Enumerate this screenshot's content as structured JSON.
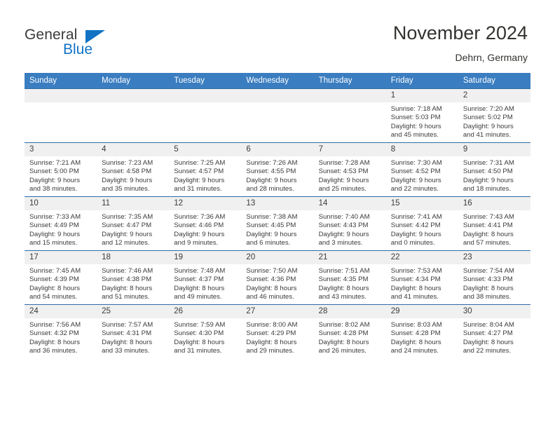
{
  "brand": {
    "name_part1": "General",
    "name_part2": "Blue",
    "logo_icon": "triangle-icon",
    "accent_color": "#1273c4"
  },
  "header": {
    "title": "November 2024",
    "location": "Dehrn, Germany"
  },
  "calendar": {
    "header_bg": "#3a7dc0",
    "daynum_bg": "#f0f0f0",
    "weekday_headers": [
      "Sunday",
      "Monday",
      "Tuesday",
      "Wednesday",
      "Thursday",
      "Friday",
      "Saturday"
    ],
    "weeks": [
      [
        {
          "day": "",
          "sunrise": "",
          "sunset": "",
          "daylight_line1": "",
          "daylight_line2": "",
          "empty": true
        },
        {
          "day": "",
          "sunrise": "",
          "sunset": "",
          "daylight_line1": "",
          "daylight_line2": "",
          "empty": true
        },
        {
          "day": "",
          "sunrise": "",
          "sunset": "",
          "daylight_line1": "",
          "daylight_line2": "",
          "empty": true
        },
        {
          "day": "",
          "sunrise": "",
          "sunset": "",
          "daylight_line1": "",
          "daylight_line2": "",
          "empty": true
        },
        {
          "day": "",
          "sunrise": "",
          "sunset": "",
          "daylight_line1": "",
          "daylight_line2": "",
          "empty": true
        },
        {
          "day": "1",
          "sunrise": "Sunrise: 7:18 AM",
          "sunset": "Sunset: 5:03 PM",
          "daylight_line1": "Daylight: 9 hours",
          "daylight_line2": "and 45 minutes.",
          "empty": false
        },
        {
          "day": "2",
          "sunrise": "Sunrise: 7:20 AM",
          "sunset": "Sunset: 5:02 PM",
          "daylight_line1": "Daylight: 9 hours",
          "daylight_line2": "and 41 minutes.",
          "empty": false
        }
      ],
      [
        {
          "day": "3",
          "sunrise": "Sunrise: 7:21 AM",
          "sunset": "Sunset: 5:00 PM",
          "daylight_line1": "Daylight: 9 hours",
          "daylight_line2": "and 38 minutes.",
          "empty": false
        },
        {
          "day": "4",
          "sunrise": "Sunrise: 7:23 AM",
          "sunset": "Sunset: 4:58 PM",
          "daylight_line1": "Daylight: 9 hours",
          "daylight_line2": "and 35 minutes.",
          "empty": false
        },
        {
          "day": "5",
          "sunrise": "Sunrise: 7:25 AM",
          "sunset": "Sunset: 4:57 PM",
          "daylight_line1": "Daylight: 9 hours",
          "daylight_line2": "and 31 minutes.",
          "empty": false
        },
        {
          "day": "6",
          "sunrise": "Sunrise: 7:26 AM",
          "sunset": "Sunset: 4:55 PM",
          "daylight_line1": "Daylight: 9 hours",
          "daylight_line2": "and 28 minutes.",
          "empty": false
        },
        {
          "day": "7",
          "sunrise": "Sunrise: 7:28 AM",
          "sunset": "Sunset: 4:53 PM",
          "daylight_line1": "Daylight: 9 hours",
          "daylight_line2": "and 25 minutes.",
          "empty": false
        },
        {
          "day": "8",
          "sunrise": "Sunrise: 7:30 AM",
          "sunset": "Sunset: 4:52 PM",
          "daylight_line1": "Daylight: 9 hours",
          "daylight_line2": "and 22 minutes.",
          "empty": false
        },
        {
          "day": "9",
          "sunrise": "Sunrise: 7:31 AM",
          "sunset": "Sunset: 4:50 PM",
          "daylight_line1": "Daylight: 9 hours",
          "daylight_line2": "and 18 minutes.",
          "empty": false
        }
      ],
      [
        {
          "day": "10",
          "sunrise": "Sunrise: 7:33 AM",
          "sunset": "Sunset: 4:49 PM",
          "daylight_line1": "Daylight: 9 hours",
          "daylight_line2": "and 15 minutes.",
          "empty": false
        },
        {
          "day": "11",
          "sunrise": "Sunrise: 7:35 AM",
          "sunset": "Sunset: 4:47 PM",
          "daylight_line1": "Daylight: 9 hours",
          "daylight_line2": "and 12 minutes.",
          "empty": false
        },
        {
          "day": "12",
          "sunrise": "Sunrise: 7:36 AM",
          "sunset": "Sunset: 4:46 PM",
          "daylight_line1": "Daylight: 9 hours",
          "daylight_line2": "and 9 minutes.",
          "empty": false
        },
        {
          "day": "13",
          "sunrise": "Sunrise: 7:38 AM",
          "sunset": "Sunset: 4:45 PM",
          "daylight_line1": "Daylight: 9 hours",
          "daylight_line2": "and 6 minutes.",
          "empty": false
        },
        {
          "day": "14",
          "sunrise": "Sunrise: 7:40 AM",
          "sunset": "Sunset: 4:43 PM",
          "daylight_line1": "Daylight: 9 hours",
          "daylight_line2": "and 3 minutes.",
          "empty": false
        },
        {
          "day": "15",
          "sunrise": "Sunrise: 7:41 AM",
          "sunset": "Sunset: 4:42 PM",
          "daylight_line1": "Daylight: 9 hours",
          "daylight_line2": "and 0 minutes.",
          "empty": false
        },
        {
          "day": "16",
          "sunrise": "Sunrise: 7:43 AM",
          "sunset": "Sunset: 4:41 PM",
          "daylight_line1": "Daylight: 8 hours",
          "daylight_line2": "and 57 minutes.",
          "empty": false
        }
      ],
      [
        {
          "day": "17",
          "sunrise": "Sunrise: 7:45 AM",
          "sunset": "Sunset: 4:39 PM",
          "daylight_line1": "Daylight: 8 hours",
          "daylight_line2": "and 54 minutes.",
          "empty": false
        },
        {
          "day": "18",
          "sunrise": "Sunrise: 7:46 AM",
          "sunset": "Sunset: 4:38 PM",
          "daylight_line1": "Daylight: 8 hours",
          "daylight_line2": "and 51 minutes.",
          "empty": false
        },
        {
          "day": "19",
          "sunrise": "Sunrise: 7:48 AM",
          "sunset": "Sunset: 4:37 PM",
          "daylight_line1": "Daylight: 8 hours",
          "daylight_line2": "and 49 minutes.",
          "empty": false
        },
        {
          "day": "20",
          "sunrise": "Sunrise: 7:50 AM",
          "sunset": "Sunset: 4:36 PM",
          "daylight_line1": "Daylight: 8 hours",
          "daylight_line2": "and 46 minutes.",
          "empty": false
        },
        {
          "day": "21",
          "sunrise": "Sunrise: 7:51 AM",
          "sunset": "Sunset: 4:35 PM",
          "daylight_line1": "Daylight: 8 hours",
          "daylight_line2": "and 43 minutes.",
          "empty": false
        },
        {
          "day": "22",
          "sunrise": "Sunrise: 7:53 AM",
          "sunset": "Sunset: 4:34 PM",
          "daylight_line1": "Daylight: 8 hours",
          "daylight_line2": "and 41 minutes.",
          "empty": false
        },
        {
          "day": "23",
          "sunrise": "Sunrise: 7:54 AM",
          "sunset": "Sunset: 4:33 PM",
          "daylight_line1": "Daylight: 8 hours",
          "daylight_line2": "and 38 minutes.",
          "empty": false
        }
      ],
      [
        {
          "day": "24",
          "sunrise": "Sunrise: 7:56 AM",
          "sunset": "Sunset: 4:32 PM",
          "daylight_line1": "Daylight: 8 hours",
          "daylight_line2": "and 36 minutes.",
          "empty": false
        },
        {
          "day": "25",
          "sunrise": "Sunrise: 7:57 AM",
          "sunset": "Sunset: 4:31 PM",
          "daylight_line1": "Daylight: 8 hours",
          "daylight_line2": "and 33 minutes.",
          "empty": false
        },
        {
          "day": "26",
          "sunrise": "Sunrise: 7:59 AM",
          "sunset": "Sunset: 4:30 PM",
          "daylight_line1": "Daylight: 8 hours",
          "daylight_line2": "and 31 minutes.",
          "empty": false
        },
        {
          "day": "27",
          "sunrise": "Sunrise: 8:00 AM",
          "sunset": "Sunset: 4:29 PM",
          "daylight_line1": "Daylight: 8 hours",
          "daylight_line2": "and 29 minutes.",
          "empty": false
        },
        {
          "day": "28",
          "sunrise": "Sunrise: 8:02 AM",
          "sunset": "Sunset: 4:28 PM",
          "daylight_line1": "Daylight: 8 hours",
          "daylight_line2": "and 26 minutes.",
          "empty": false
        },
        {
          "day": "29",
          "sunrise": "Sunrise: 8:03 AM",
          "sunset": "Sunset: 4:28 PM",
          "daylight_line1": "Daylight: 8 hours",
          "daylight_line2": "and 24 minutes.",
          "empty": false
        },
        {
          "day": "30",
          "sunrise": "Sunrise: 8:04 AM",
          "sunset": "Sunset: 4:27 PM",
          "daylight_line1": "Daylight: 8 hours",
          "daylight_line2": "and 22 minutes.",
          "empty": false
        }
      ]
    ]
  }
}
